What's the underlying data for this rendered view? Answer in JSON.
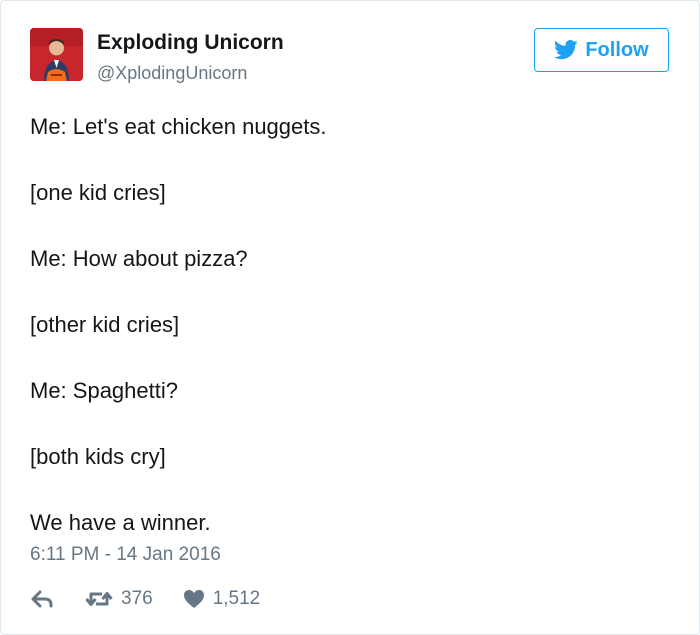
{
  "tweet": {
    "author_name": "Exploding Unicorn",
    "author_handle": "@XplodingUnicorn",
    "follow_label": "Follow",
    "lines": [
      "Me: Let's eat chicken nuggets.",
      "[one kid cries]",
      "Me: How about pizza?",
      "[other kid cries]",
      "Me: Spaghetti?",
      "[both kids cry]",
      "We have a winner."
    ],
    "timestamp": "6:11 PM - 14 Jan 2016",
    "retweet_count": "376",
    "like_count": "1,512"
  },
  "colors": {
    "accent": "#1da1f2",
    "secondary_text": "#657786",
    "primary_text": "#14171a",
    "avatar_bg": "#d9242b"
  },
  "icons": {
    "follow": "twitter-bird-icon",
    "reply": "reply-arrow-icon",
    "retweet": "retweet-icon",
    "like": "heart-icon"
  }
}
